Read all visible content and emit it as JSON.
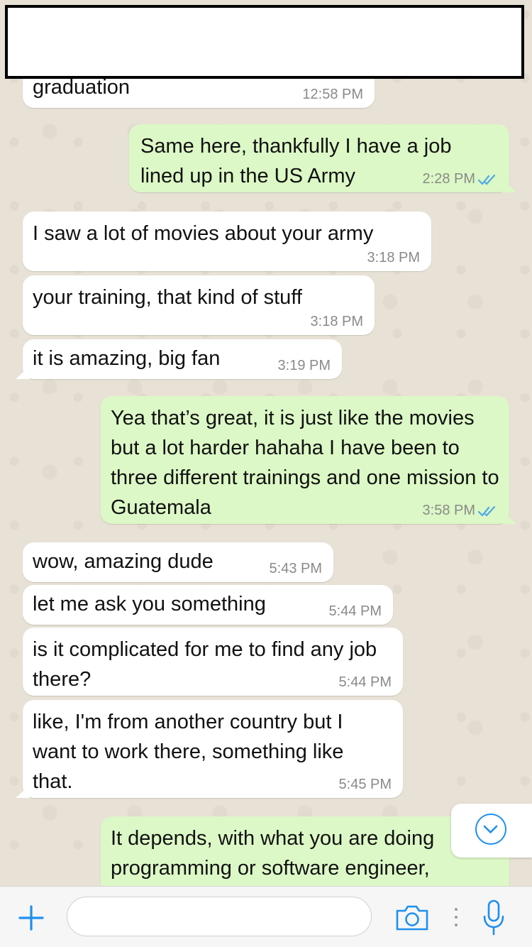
{
  "messages": [
    {
      "dir": "in",
      "text": "graduation",
      "time": "12:58 PM"
    },
    {
      "dir": "out",
      "text": "Same here, thankfully I have a job lined up in the US Army",
      "time": "2:28 PM"
    },
    {
      "dir": "in",
      "text": "I saw a lot of movies about your army",
      "time": "3:18 PM"
    },
    {
      "dir": "in",
      "text": "your training, that kind of stuff",
      "time": "3:18 PM"
    },
    {
      "dir": "in",
      "text": "it is amazing, big fan",
      "time": "3:19 PM"
    },
    {
      "dir": "out",
      "text": "Yea that’s great, it is just like the movies but a lot harder hahaha I have been to three different trainings and one mission to Guatemala",
      "time": "3:58 PM"
    },
    {
      "dir": "in",
      "text": "wow, amazing dude",
      "time": "5:43 PM"
    },
    {
      "dir": "in",
      "text": "let me ask you something",
      "time": "5:44 PM"
    },
    {
      "dir": "in",
      "text": "is it complicated for me to find any job there?",
      "time": "5:44 PM"
    },
    {
      "dir": "in",
      "text": "like, I'm from another country but I want to work there, something like that.",
      "time": "5:45 PM"
    },
    {
      "dir": "out",
      "text": "It depends, with what you are doing programming or software engineer,",
      "time": ""
    }
  ],
  "colors": {
    "incoming": "#ffffff",
    "outgoing": "#dcf8c6",
    "accent": "#1e8ff0",
    "read_ticks": "#4fa9e6"
  },
  "icons": {
    "attach": "plus-icon",
    "camera": "camera-icon",
    "mic": "microphone-icon",
    "scroll": "chevron-down-icon",
    "read": "double-check-icon"
  },
  "composer": {
    "placeholder": ""
  }
}
